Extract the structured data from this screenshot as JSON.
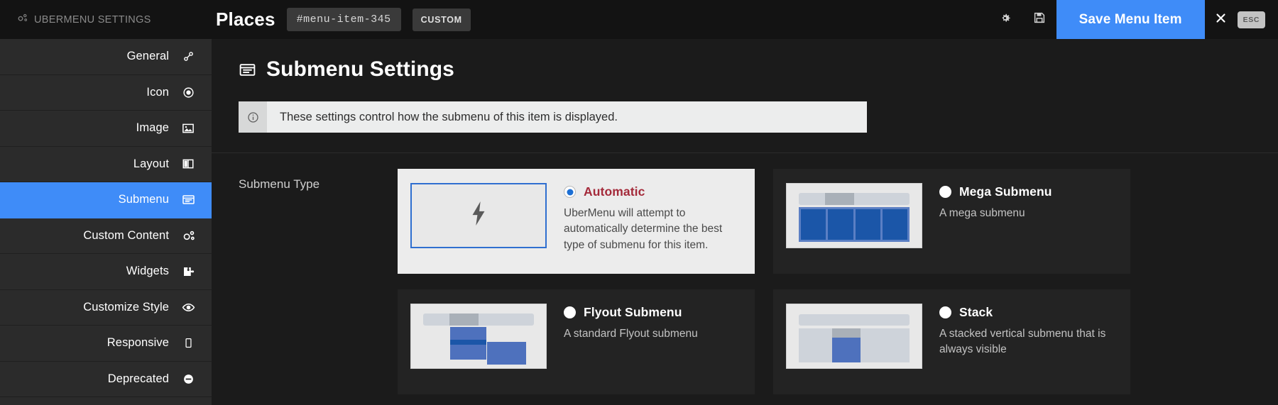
{
  "topbar": {
    "brand_label": "UBERMENU SETTINGS",
    "brand_icon": "gears-icon",
    "menu_title": "Places",
    "item_id": "#menu-item-345",
    "custom_badge": "CUSTOM",
    "settings_icon": "gear-icon",
    "save_icon": "floppy-disk-icon",
    "save_label": "Save Menu Item",
    "close_icon": "close-icon",
    "esc_label": "ESC",
    "accent_color": "#3f8cf8",
    "background_color": "#131313"
  },
  "sidebar": {
    "items": [
      {
        "label": "General",
        "icon": "link-icon",
        "active": false
      },
      {
        "label": "Icon",
        "icon": "target-icon",
        "active": false
      },
      {
        "label": "Image",
        "icon": "image-icon",
        "active": false
      },
      {
        "label": "Layout",
        "icon": "columns-icon",
        "active": false
      },
      {
        "label": "Submenu",
        "icon": "submenu-panel-icon",
        "active": true
      },
      {
        "label": "Custom Content",
        "icon": "gears-icon",
        "active": false
      },
      {
        "label": "Widgets",
        "icon": "puzzle-piece-icon",
        "active": false
      },
      {
        "label": "Customize Style",
        "icon": "eye-icon",
        "active": false
      },
      {
        "label": "Responsive",
        "icon": "mobile-icon",
        "active": false
      },
      {
        "label": "Deprecated",
        "icon": "minus-circle-icon",
        "active": false
      }
    ]
  },
  "main": {
    "page_title": "Submenu Settings",
    "page_title_icon": "submenu-panel-icon",
    "notice_icon": "info-icon",
    "notice_text": "These settings control how the submenu of this item is displayed.",
    "field_label": "Submenu Type",
    "options": [
      {
        "name": "Automatic",
        "description": "UberMenu will attempt to automatically determine the best type of submenu for this item.",
        "selected": true,
        "thumbnail": "lightning-bolt-thumbnail"
      },
      {
        "name": "Mega Submenu",
        "description": "A mega submenu",
        "selected": false,
        "thumbnail": "mega-columns-thumbnail"
      },
      {
        "name": "Flyout Submenu",
        "description": "A standard Flyout submenu",
        "selected": false,
        "thumbnail": "flyout-thumbnail"
      },
      {
        "name": "Stack",
        "description": "A stacked vertical submenu that is always visible",
        "selected": false,
        "thumbnail": "stack-thumbnail"
      }
    ]
  }
}
